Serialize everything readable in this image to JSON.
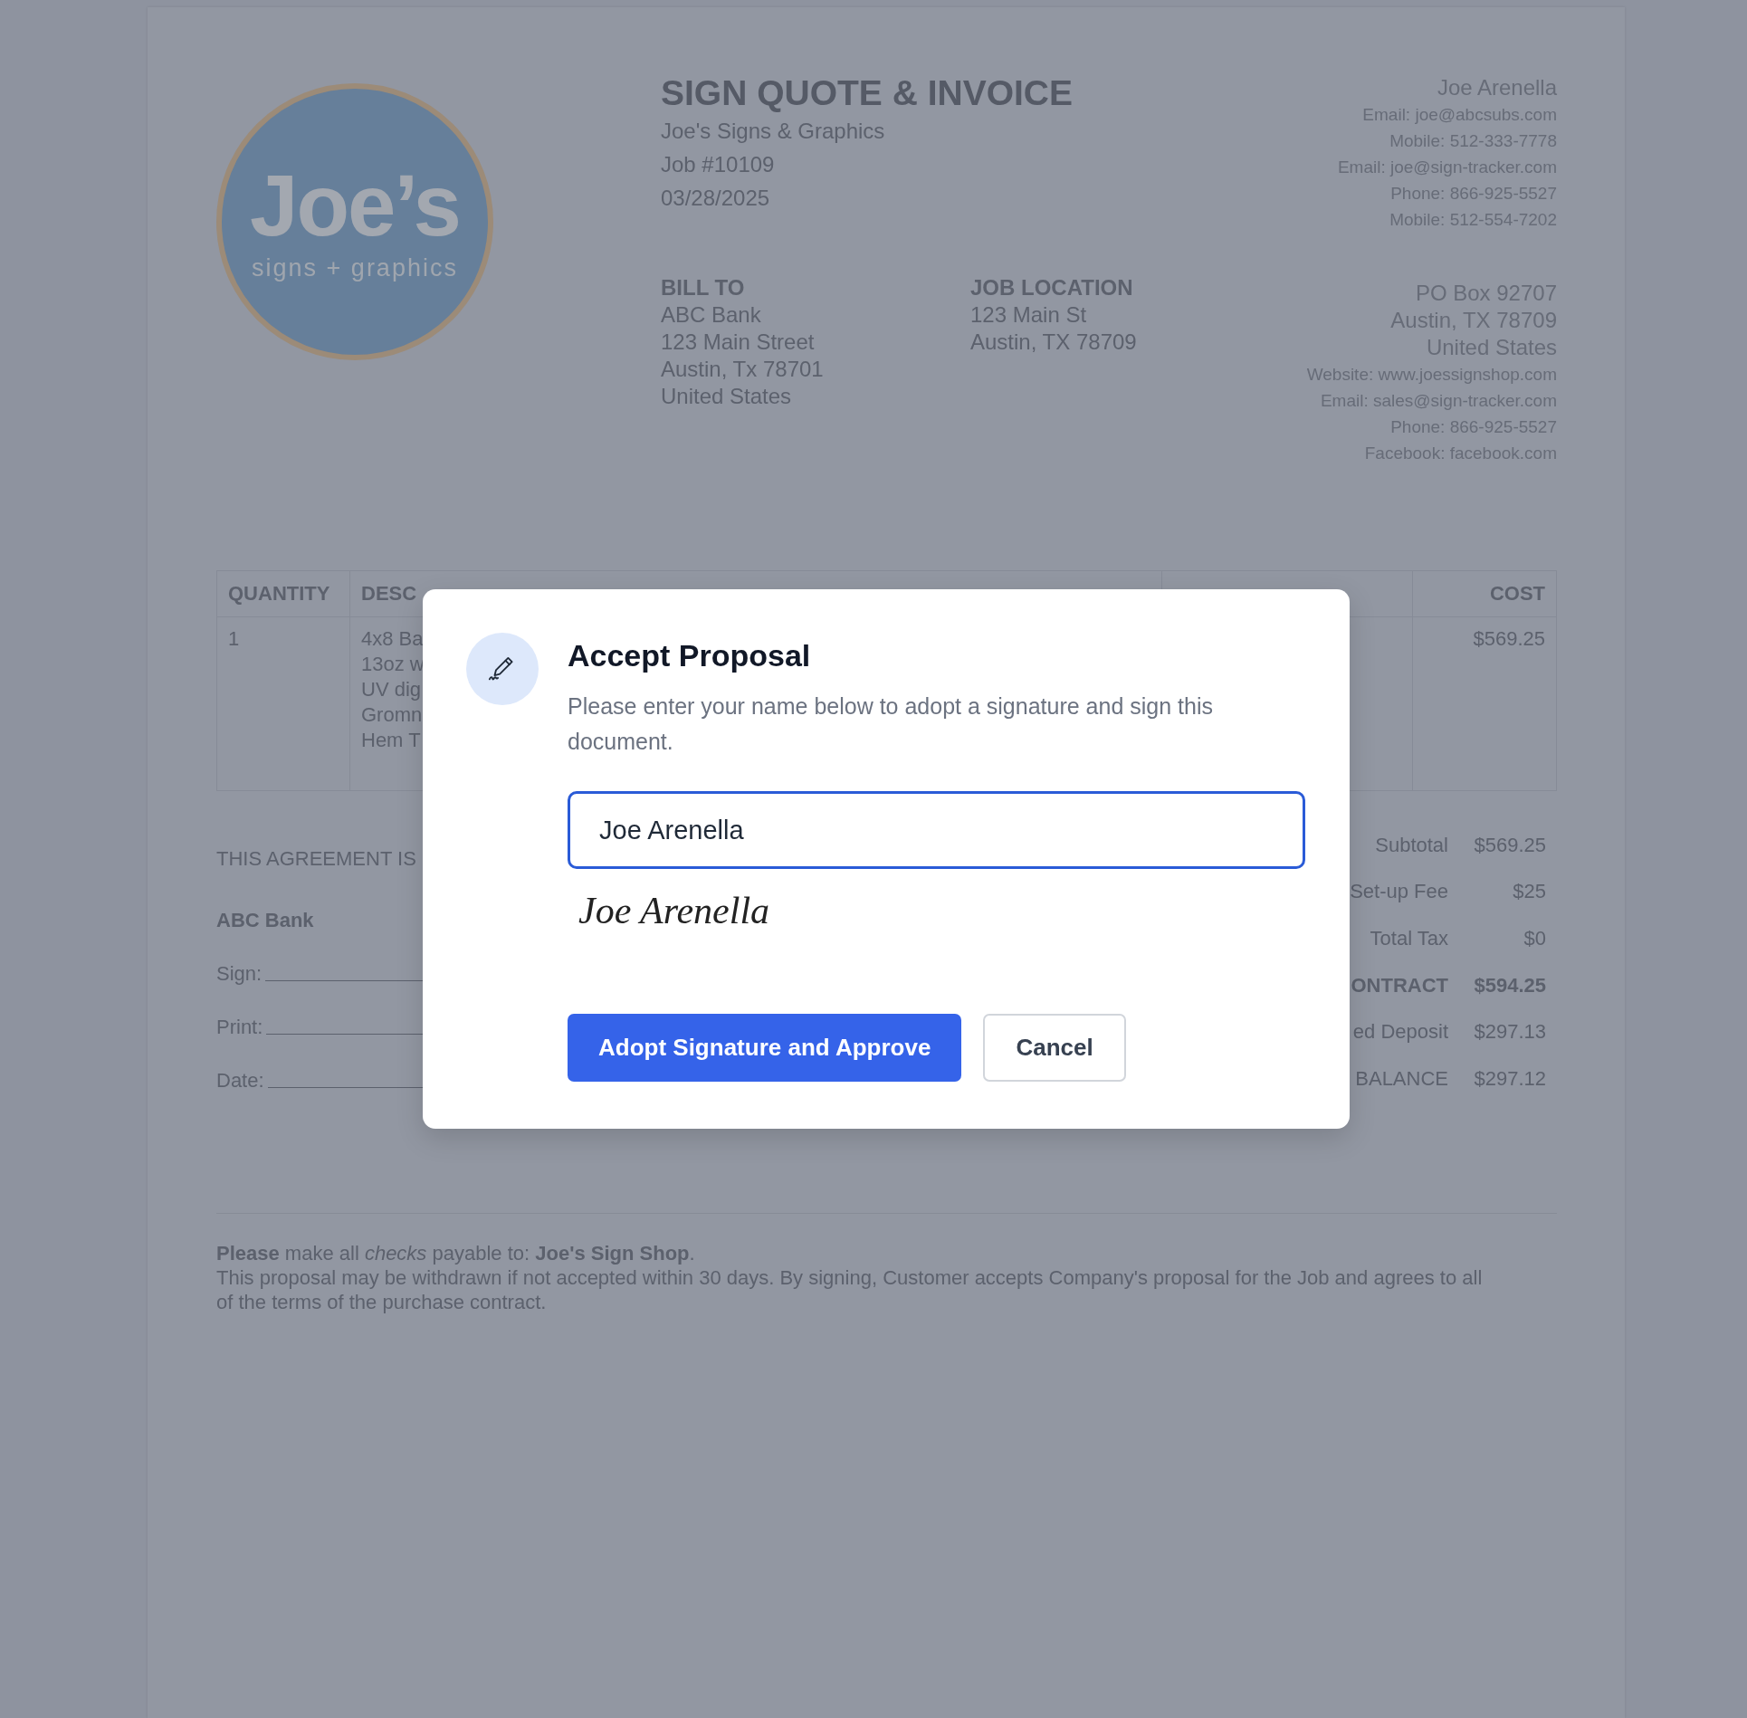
{
  "document": {
    "logo": {
      "name": "Joe’s",
      "tagline": "signs + graphics"
    },
    "title": "SIGN QUOTE & INVOICE",
    "company": "Joe's Signs & Graphics",
    "job": "Job #10109",
    "date": "03/28/2025",
    "contact": {
      "name": "Joe Arenella",
      "lines": [
        "Email: joe@abcsubs.com",
        "Mobile: 512-333-7778",
        "Email: joe@sign-tracker.com",
        "Phone: 866-925-5527",
        "Mobile: 512-554-7202"
      ]
    },
    "bill_to": {
      "heading": "BILL TO",
      "lines": [
        "ABC Bank",
        "123 Main Street",
        "Austin, Tx 78701",
        "United States"
      ]
    },
    "job_location": {
      "heading": "JOB LOCATION",
      "lines": [
        "123 Main St",
        "Austin, TX 78709"
      ]
    },
    "company_address": {
      "lines": [
        "PO Box 92707",
        "Austin, TX 78709",
        "United States"
      ],
      "details": [
        "Website: www.joessignshop.com",
        "Email: sales@sign-tracker.com",
        "Phone: 866-925-5527",
        "Facebook: facebook.com"
      ]
    },
    "table": {
      "columns": [
        "QUANTITY",
        "DESC",
        "COST"
      ],
      "rows": [
        {
          "quantity": "1",
          "description": [
            "4x8 Ba",
            "13oz w",
            "UV dig",
            "Gromn",
            "Hem T"
          ],
          "cost": "$569.25"
        }
      ]
    },
    "agreement": {
      "text": "THIS AGREEMENT IS",
      "customer": "ABC Bank",
      "sign_lines": [
        "Sign:",
        "Print:",
        "Date:"
      ]
    },
    "totals": [
      {
        "label": "Subtotal",
        "value": "$569.25",
        "bold": false
      },
      {
        "label": "Set-up Fee",
        "value": "$25",
        "bold": false
      },
      {
        "label": "Total Tax",
        "value": "$0",
        "bold": false
      },
      {
        "label": "ONTRACT",
        "value": "$594.25",
        "bold": true
      },
      {
        "label": "ed Deposit",
        "value": "$297.13",
        "bold": false
      },
      {
        "label": "BALANCE",
        "value": "$297.12",
        "bold": false
      }
    ],
    "footer": {
      "payable": "**Please** make all *checks* payable to: **Joe's Sign Shop**.",
      "terms": "This proposal may be withdrawn if not accepted within 30 days. By signing, Customer accepts Company's proposal for the Job and agrees to all of the terms of the purchase contract."
    }
  },
  "modal": {
    "title": "Accept Proposal",
    "message": "Please enter your name below to adopt a signature and sign this document.",
    "name_field": {
      "value": "Joe Arenella"
    },
    "signature": "Joe Arenella",
    "buttons": [
      {
        "label": "Adopt Signature and Approve",
        "kind": "primary"
      },
      {
        "label": "Cancel",
        "kind": "secondary"
      }
    ]
  }
}
